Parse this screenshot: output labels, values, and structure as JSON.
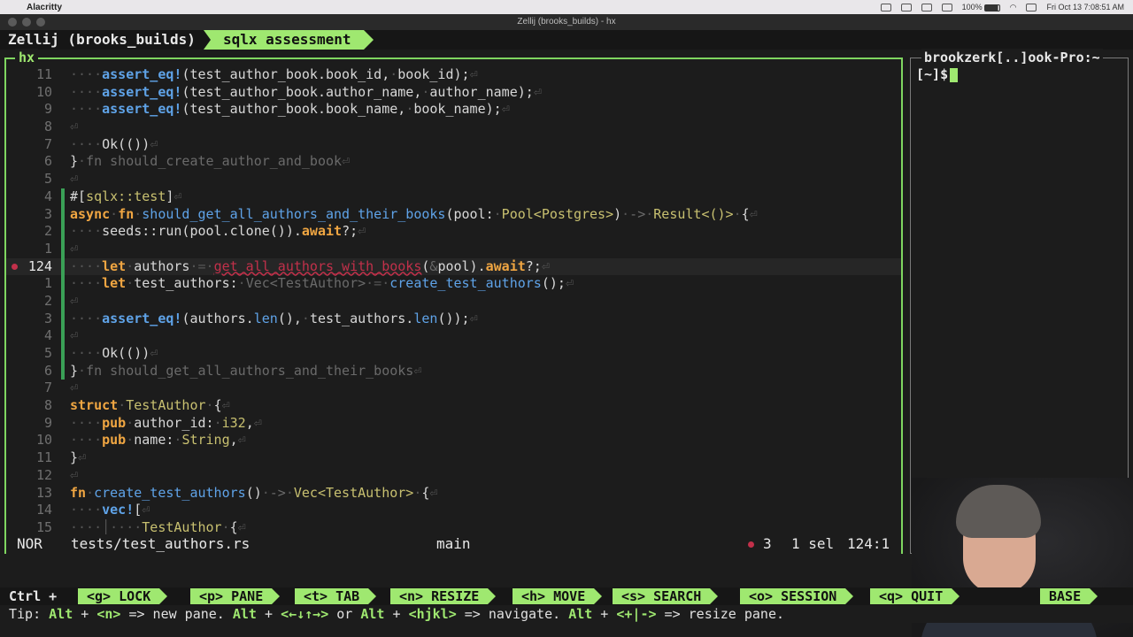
{
  "menubar": {
    "app_name": "Alacritty",
    "clock": "Fri Oct 13  7:08:51 AM",
    "battery": "100%"
  },
  "window": {
    "title": "Zellij (brooks_builds) - hx"
  },
  "zellij": {
    "session_label": "Zellij (brooks_builds)",
    "active_tab": "sqlx assessment",
    "ctrl_label": "Ctrl +",
    "keybindings": [
      {
        "key": "<g>",
        "label": "LOCK"
      },
      {
        "key": "<p>",
        "label": "PANE"
      },
      {
        "key": "<t>",
        "label": "TAB"
      },
      {
        "key": "<n>",
        "label": "RESIZE"
      },
      {
        "key": "<h>",
        "label": "MOVE"
      },
      {
        "key": "<s>",
        "label": "SEARCH"
      },
      {
        "key": "<o>",
        "label": "SESSION"
      },
      {
        "key": "<q>",
        "label": "QUIT"
      },
      {
        "key": "",
        "label": "BASE"
      }
    ],
    "tip": {
      "prefix": "Tip: ",
      "p1": "Alt",
      "t1": " + ",
      "p2": "<n>",
      "t2": " => new pane. ",
      "p3": "Alt",
      "t3": " + ",
      "p4": "<←↓↑→>",
      "t4": " or ",
      "p5": "Alt",
      "t5": " + ",
      "p6": "<hjkl>",
      "t6": " => navigate. ",
      "p7": "Alt",
      "t7": " + ",
      "p8": "<+|->",
      "t8": " => resize pane."
    }
  },
  "editor": {
    "pane_title": "hx",
    "mode": "NOR",
    "file": "tests/test_authors.rs",
    "branch": "main",
    "diagnostic_count": "3",
    "selection": "1 sel",
    "position": "124:1",
    "lines": [
      {
        "num": "11",
        "segs": [
          [
            "ws",
            "····"
          ],
          [
            "macro",
            "assert_eq!"
          ],
          [
            "plain",
            "(test_author_book.book_id,"
          ],
          [
            "ws",
            "·"
          ],
          [
            "plain",
            "book_id);"
          ],
          [
            "ws",
            "⏎"
          ]
        ]
      },
      {
        "num": "10",
        "segs": [
          [
            "ws",
            "····"
          ],
          [
            "macro",
            "assert_eq!"
          ],
          [
            "plain",
            "(test_author_book.author_name,"
          ],
          [
            "ws",
            "·"
          ],
          [
            "plain",
            "author_name);"
          ],
          [
            "ws",
            "⏎"
          ]
        ]
      },
      {
        "num": "9",
        "segs": [
          [
            "ws",
            "····"
          ],
          [
            "macro",
            "assert_eq!"
          ],
          [
            "plain",
            "(test_author_book.book_name,"
          ],
          [
            "ws",
            "·"
          ],
          [
            "plain",
            "book_name);"
          ],
          [
            "ws",
            "⏎"
          ]
        ]
      },
      {
        "num": "8",
        "segs": [
          [
            "ws",
            "⏎"
          ]
        ]
      },
      {
        "num": "7",
        "segs": [
          [
            "ws",
            "····"
          ],
          [
            "plain",
            "Ok(())"
          ],
          [
            "ws",
            "⏎"
          ]
        ]
      },
      {
        "num": "6",
        "segs": [
          [
            "plain",
            "}"
          ],
          [
            "ws",
            "·"
          ],
          [
            "dim",
            "fn should_create_author_and_book"
          ],
          [
            "ws",
            "⏎"
          ]
        ]
      },
      {
        "num": "5",
        "segs": [
          [
            "ws",
            "⏎"
          ]
        ]
      },
      {
        "num": "4",
        "segs": [
          [
            "plain",
            "#["
          ],
          [
            "attr",
            "sqlx::test"
          ],
          [
            "plain",
            "]"
          ],
          [
            "ws",
            "⏎"
          ]
        ]
      },
      {
        "num": "3",
        "segs": [
          [
            "kw",
            "async"
          ],
          [
            "ws",
            "·"
          ],
          [
            "kw",
            "fn"
          ],
          [
            "ws",
            "·"
          ],
          [
            "fn",
            "should_get_all_authors_and_their_books"
          ],
          [
            "plain",
            "(pool:"
          ],
          [
            "ws",
            "·"
          ],
          [
            "type",
            "Pool<Postgres>"
          ],
          [
            "plain",
            ")"
          ],
          [
            "ws",
            "·"
          ],
          [
            "dim",
            "->"
          ],
          [
            "ws",
            "·"
          ],
          [
            "type",
            "Result<()>"
          ],
          [
            "ws",
            "·"
          ],
          [
            "plain",
            "{"
          ],
          [
            "ws",
            "⏎"
          ]
        ]
      },
      {
        "num": "2",
        "segs": [
          [
            "ws",
            "····"
          ],
          [
            "plain",
            "seeds::run(pool.clone())."
          ],
          [
            "kw",
            "await"
          ],
          [
            "plain",
            "?;"
          ],
          [
            "ws",
            "⏎"
          ]
        ]
      },
      {
        "num": "1",
        "segs": [
          [
            "ws",
            "⏎"
          ]
        ]
      },
      {
        "num": "124",
        "current": true,
        "diag": true,
        "segs": [
          [
            "ws",
            "····"
          ],
          [
            "kw",
            "let"
          ],
          [
            "ws",
            "·"
          ],
          [
            "plain",
            "authors"
          ],
          [
            "ws",
            "·=·"
          ],
          [
            "err",
            "get_all_authors_with_books"
          ],
          [
            "plain",
            "("
          ],
          [
            "dim",
            "&"
          ],
          [
            "plain",
            "pool)."
          ],
          [
            "kw",
            "await"
          ],
          [
            "plain",
            "?;"
          ],
          [
            "ws",
            "⏎"
          ]
        ]
      },
      {
        "num": "1",
        "segs": [
          [
            "ws",
            "····"
          ],
          [
            "kw",
            "let"
          ],
          [
            "ws",
            "·"
          ],
          [
            "plain",
            "test_authors:"
          ],
          [
            "ws",
            "·"
          ],
          [
            "dim",
            "Vec<TestAuthor>"
          ],
          [
            "ws",
            "·=·"
          ],
          [
            "fn",
            "create_test_authors"
          ],
          [
            "plain",
            "();"
          ],
          [
            "ws",
            "⏎"
          ]
        ]
      },
      {
        "num": "2",
        "segs": [
          [
            "ws",
            "⏎"
          ]
        ]
      },
      {
        "num": "3",
        "segs": [
          [
            "ws",
            "····"
          ],
          [
            "macro",
            "assert_eq!"
          ],
          [
            "plain",
            "(authors."
          ],
          [
            "fn",
            "len"
          ],
          [
            "plain",
            "(),"
          ],
          [
            "ws",
            "·"
          ],
          [
            "plain",
            "test_authors."
          ],
          [
            "fn",
            "len"
          ],
          [
            "plain",
            "());"
          ],
          [
            "ws",
            "⏎"
          ]
        ]
      },
      {
        "num": "4",
        "segs": [
          [
            "ws",
            "⏎"
          ]
        ]
      },
      {
        "num": "5",
        "segs": [
          [
            "ws",
            "····"
          ],
          [
            "plain",
            "Ok(())"
          ],
          [
            "ws",
            "⏎"
          ]
        ]
      },
      {
        "num": "6",
        "segs": [
          [
            "plain",
            "}"
          ],
          [
            "ws",
            "·"
          ],
          [
            "dim",
            "fn should_get_all_authors_and_their_books"
          ],
          [
            "ws",
            "⏎"
          ]
        ]
      },
      {
        "num": "7",
        "segs": [
          [
            "ws",
            "⏎"
          ]
        ]
      },
      {
        "num": "8",
        "segs": [
          [
            "kw",
            "struct"
          ],
          [
            "ws",
            "·"
          ],
          [
            "type",
            "TestAuthor"
          ],
          [
            "ws",
            "·"
          ],
          [
            "plain",
            "{"
          ],
          [
            "ws",
            "⏎"
          ]
        ]
      },
      {
        "num": "9",
        "segs": [
          [
            "ws",
            "····"
          ],
          [
            "kw",
            "pub"
          ],
          [
            "ws",
            "·"
          ],
          [
            "plain",
            "author_id:"
          ],
          [
            "ws",
            "·"
          ],
          [
            "type",
            "i32"
          ],
          [
            "plain",
            ","
          ],
          [
            "ws",
            "⏎"
          ]
        ]
      },
      {
        "num": "10",
        "segs": [
          [
            "ws",
            "····"
          ],
          [
            "kw",
            "pub"
          ],
          [
            "ws",
            "·"
          ],
          [
            "plain",
            "name:"
          ],
          [
            "ws",
            "·"
          ],
          [
            "type",
            "String"
          ],
          [
            "plain",
            ","
          ],
          [
            "ws",
            "⏎"
          ]
        ]
      },
      {
        "num": "11",
        "segs": [
          [
            "plain",
            "}"
          ],
          [
            "ws",
            "⏎"
          ]
        ]
      },
      {
        "num": "12",
        "segs": [
          [
            "ws",
            "⏎"
          ]
        ]
      },
      {
        "num": "13",
        "segs": [
          [
            "kw",
            "fn"
          ],
          [
            "ws",
            "·"
          ],
          [
            "fn",
            "create_test_authors"
          ],
          [
            "plain",
            "()"
          ],
          [
            "ws",
            "·"
          ],
          [
            "dim",
            "->"
          ],
          [
            "ws",
            "·"
          ],
          [
            "type",
            "Vec<TestAuthor>"
          ],
          [
            "ws",
            "·"
          ],
          [
            "plain",
            "{"
          ],
          [
            "ws",
            "⏎"
          ]
        ]
      },
      {
        "num": "14",
        "segs": [
          [
            "ws",
            "····"
          ],
          [
            "macro",
            "vec!"
          ],
          [
            "plain",
            "["
          ],
          [
            "ws",
            "⏎"
          ]
        ]
      },
      {
        "num": "15",
        "segs": [
          [
            "ws",
            "····│····"
          ],
          [
            "type",
            "TestAuthor"
          ],
          [
            "ws",
            "·"
          ],
          [
            "plain",
            "{"
          ],
          [
            "ws",
            "⏎"
          ]
        ]
      }
    ]
  },
  "terminal": {
    "pane_title": "brookzerk[..]ook-Pro:~",
    "prompt": "[~]$"
  },
  "colors": {
    "accent": "#9fe870",
    "error": "#c2304a",
    "keyword": "#f0a642",
    "function": "#5fa3e8",
    "type": "#c8c070"
  }
}
